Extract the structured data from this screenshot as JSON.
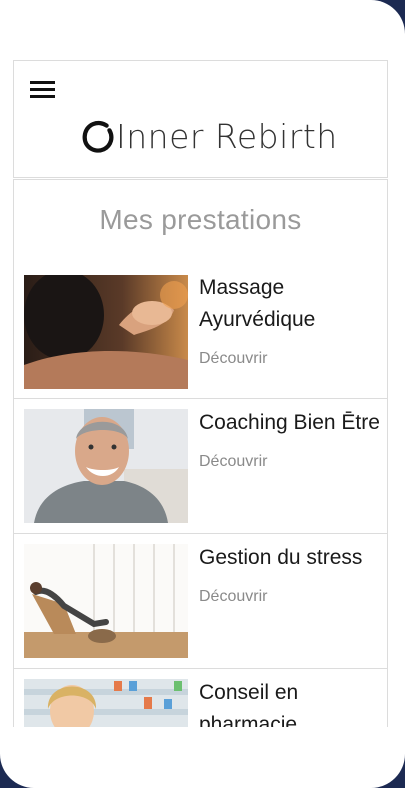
{
  "brand": {
    "logo_text": "Inner Rebirth"
  },
  "section": {
    "title": "Mes prestations"
  },
  "services": [
    {
      "title": "Massage Ayurvédique",
      "link": "Découvrir",
      "image": "massage-photo"
    },
    {
      "title": "Coaching Bien Ētre",
      "link": "Découvrir",
      "image": "smiling-man-photo"
    },
    {
      "title": "Gestion du stress",
      "link": "Découvrir",
      "image": "relaxing-chair-photo"
    },
    {
      "title": "Conseil en pharmacie",
      "link": "",
      "image": "pharmacist-photo"
    }
  ],
  "icons": {
    "menu": "hamburger-menu-icon",
    "logo": "enso-circle-icon"
  },
  "colors": {
    "frame": "#1c2a52",
    "title_gray": "#9a9a9a",
    "border": "#dcdcdc"
  }
}
